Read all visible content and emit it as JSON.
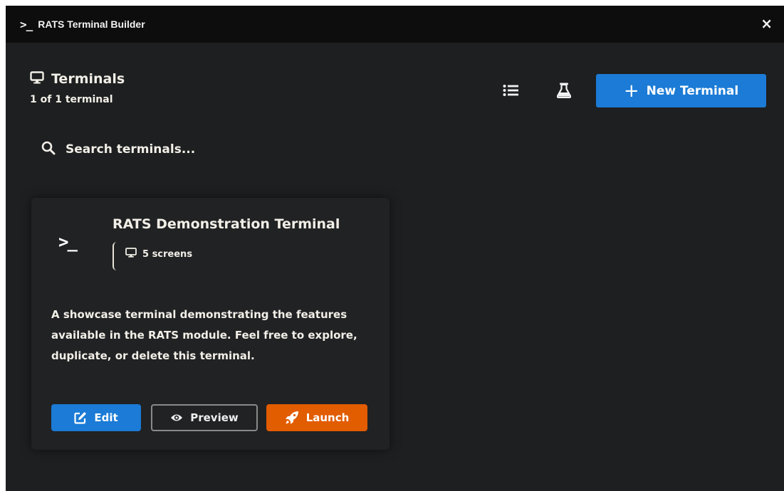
{
  "window": {
    "title": "RATS Terminal Builder",
    "icon": "terminal-prompt-icon",
    "close_label": "×"
  },
  "header": {
    "title": "Terminals",
    "icon": "monitor-icon",
    "count": "1 of 1 terminal"
  },
  "toolbar": {
    "list_icon": "list-icon",
    "flask_icon": "flask-icon",
    "new_terminal_label": "New Terminal"
  },
  "search": {
    "placeholder": "Search terminals...",
    "value": ""
  },
  "terminals": [
    {
      "name": "RATS Demonstration Terminal",
      "icon_glyph": ">_",
      "screens": "5 screens",
      "description": "A showcase terminal demonstrating the features available in the RATS module. Feel free to explore, duplicate, or delete this terminal.",
      "actions": {
        "edit": "Edit",
        "preview": "Preview",
        "launch": "Launch"
      }
    }
  ],
  "colors": {
    "background": "#1e1f20",
    "titlebar": "#0d0d0e",
    "card": "#212223",
    "primary": "#1b7bd6",
    "launch": "#e25c00",
    "text": "#f2efe8"
  }
}
